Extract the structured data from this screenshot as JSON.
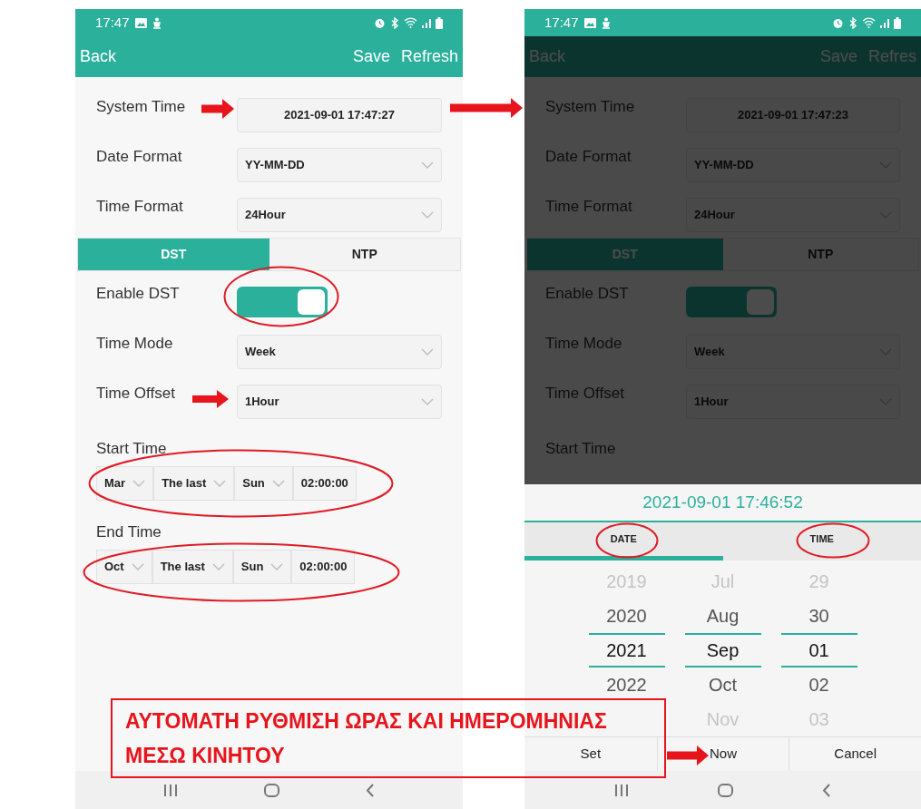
{
  "phones": [
    {
      "status_time": "17:47",
      "dimmed": false,
      "app_bar": {
        "back": "Back",
        "actions": [
          "Save",
          "Refresh"
        ]
      },
      "settings": [
        {
          "label": "System Time",
          "value": "2021-09-01 17:47:27",
          "kind": "display"
        },
        {
          "label": "Date Format",
          "value": "YY-MM-DD",
          "kind": "select"
        },
        {
          "label": "Time Format",
          "value": "24Hour",
          "kind": "select"
        }
      ],
      "tabs": [
        {
          "label": "DST",
          "selected": true
        },
        {
          "label": "NTP",
          "selected": false
        }
      ],
      "enable_dst": {
        "label": "Enable DST",
        "on": true
      },
      "dst_settings": [
        {
          "label": "Time Mode",
          "value": "Week",
          "kind": "select"
        },
        {
          "label": "Time Offset",
          "value": "1Hour",
          "kind": "select"
        }
      ],
      "periods": [
        {
          "label": "Start Time",
          "parts": [
            {
              "value": "Mar",
              "kind": "select"
            },
            {
              "value": "The last",
              "kind": "select"
            },
            {
              "value": "Sun",
              "kind": "select"
            },
            {
              "value": "02:00:00",
              "kind": "display"
            }
          ]
        },
        {
          "label": "End Time",
          "parts": [
            {
              "value": "Oct",
              "kind": "select"
            },
            {
              "value": "The last",
              "kind": "select"
            },
            {
              "value": "Sun",
              "kind": "select"
            },
            {
              "value": "02:00:00",
              "kind": "display"
            }
          ]
        }
      ]
    },
    {
      "status_time": "17:47",
      "dimmed": true,
      "app_bar": {
        "back": "Back",
        "actions": [
          "Save",
          "Refres"
        ]
      },
      "settings": [
        {
          "label": "System Time",
          "value": "2021-09-01 17:47:23",
          "kind": "display"
        },
        {
          "label": "Date Format",
          "value": "YY-MM-DD",
          "kind": "select"
        },
        {
          "label": "Time Format",
          "value": "24Hour",
          "kind": "select"
        }
      ],
      "tabs": [
        {
          "label": "DST",
          "selected": true
        },
        {
          "label": "NTP",
          "selected": false
        }
      ],
      "enable_dst": {
        "label": "Enable DST",
        "on": true
      },
      "dst_settings": [
        {
          "label": "Time Mode",
          "value": "Week",
          "kind": "select"
        },
        {
          "label": "Time Offset",
          "value": "1Hour",
          "kind": "select"
        }
      ],
      "periods": [
        {
          "label": "Start Time"
        }
      ],
      "dialog": {
        "title": "2021-09-01 17:46:52",
        "tabs": [
          {
            "label": "DATE",
            "selected": true
          },
          {
            "label": "TIME",
            "selected": false
          }
        ],
        "wheels": [
          {
            "items": [
              {
                "label": "2019",
                "selected": false,
                "faded": true
              },
              {
                "label": "2020",
                "selected": false,
                "faded": false
              },
              {
                "label": "2021",
                "selected": true,
                "faded": false
              },
              {
                "label": "2022",
                "selected": false,
                "faded": false
              }
            ]
          },
          {
            "items": [
              {
                "label": "Jul",
                "selected": false,
                "faded": true
              },
              {
                "label": "Aug",
                "selected": false,
                "faded": false
              },
              {
                "label": "Sep",
                "selected": true,
                "faded": false
              },
              {
                "label": "Oct",
                "selected": false,
                "faded": false
              },
              {
                "label": "Nov",
                "selected": false,
                "faded": true
              }
            ]
          },
          {
            "items": [
              {
                "label": "29",
                "selected": false,
                "faded": true
              },
              {
                "label": "30",
                "selected": false,
                "faded": false
              },
              {
                "label": "01",
                "selected": true,
                "faded": false
              },
              {
                "label": "02",
                "selected": false,
                "faded": false
              },
              {
                "label": "03",
                "selected": false,
                "faded": true
              }
            ]
          }
        ],
        "buttons": [
          "Set",
          "Now",
          "Cancel"
        ]
      }
    }
  ],
  "annotation": {
    "lines": [
      "ΑΥΤΟΜΑΤΗ ΡΥΘΜΙΣΗ ΩΡΑΣ ΚΑΙ ΗΜΕΡΟΜΗΝΙΑΣ",
      "ΜΕΣΩ ΚΙΝΗΤΟΥ"
    ]
  }
}
